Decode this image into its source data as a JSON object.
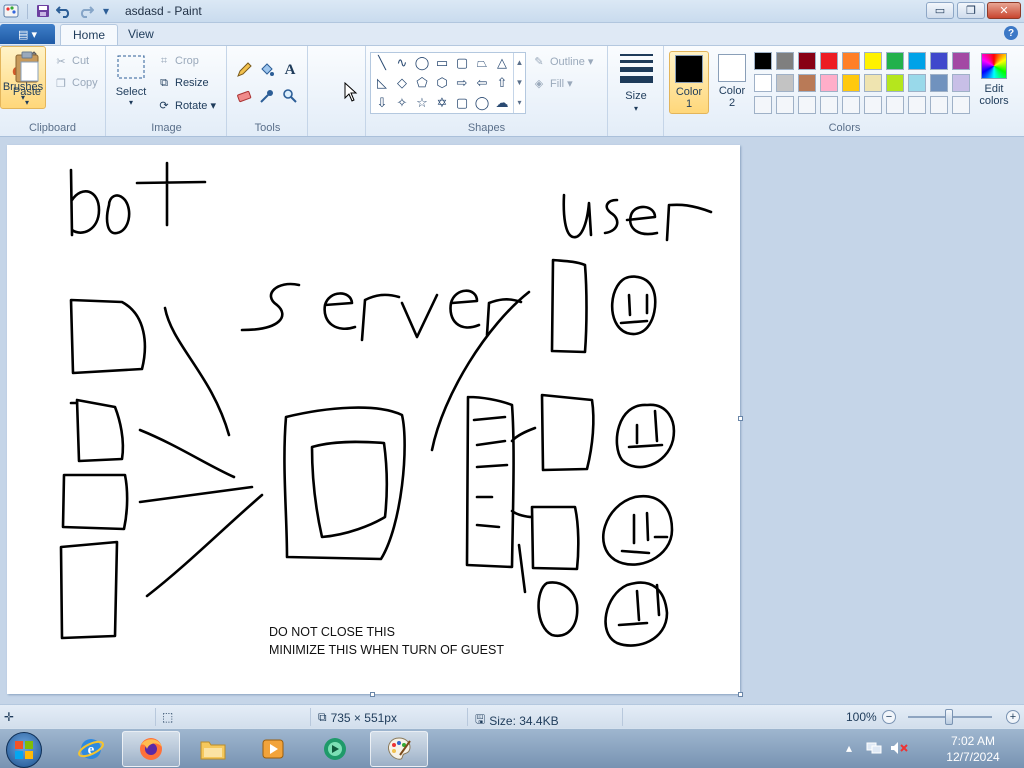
{
  "window": {
    "title": "asdasd - Paint",
    "controls": {
      "minimize": "▭",
      "maximize": "❐",
      "close": "✕"
    }
  },
  "quick_access": {
    "file_menu_label": "▤ ▾"
  },
  "tabs": [
    {
      "label": "Home",
      "active": true
    },
    {
      "label": "View",
      "active": false
    }
  ],
  "ribbon": {
    "clipboard": {
      "label": "Clipboard",
      "paste": "Paste",
      "cut": "Cut",
      "copy": "Copy"
    },
    "image": {
      "label": "Image",
      "select": "Select",
      "crop": "Crop",
      "resize": "Resize",
      "rotate": "Rotate ▾"
    },
    "tools": {
      "label": "Tools",
      "text_tool": "A"
    },
    "brushes": {
      "label": "Brushes"
    },
    "shapes": {
      "label": "Shapes",
      "outline": "Outline ▾",
      "fill": "Fill ▾"
    },
    "size": {
      "label": "Size"
    },
    "colors": {
      "label": "Colors",
      "color1_label": "Color 1",
      "color2_label": "Color 2",
      "color1_value": "#000000",
      "color2_value": "#ffffff",
      "edit_label": "Edit colors",
      "palette_row1": [
        "#000000",
        "#7f7f7f",
        "#880015",
        "#ed1c24",
        "#ff7f27",
        "#fff200",
        "#22b14c",
        "#00a2e8",
        "#3f48cc",
        "#a349a4"
      ],
      "palette_row2": [
        "#ffffff",
        "#c3c3c3",
        "#b97a57",
        "#ffaec9",
        "#ffc90e",
        "#efe4b0",
        "#b5e61d",
        "#99d9ea",
        "#7092be",
        "#c8bfe7"
      ]
    }
  },
  "canvas": {
    "note_line1": "DO NOT CLOSE THIS",
    "note_line2": "MINIMIZE THIS WHEN TURN OF GUEST"
  },
  "statusbar": {
    "dimensions": "735 × 551px",
    "size": "Size: 34.4KB",
    "zoom": "100%"
  },
  "taskbar": {
    "time": "7:02 AM",
    "date": "12/7/2024"
  }
}
